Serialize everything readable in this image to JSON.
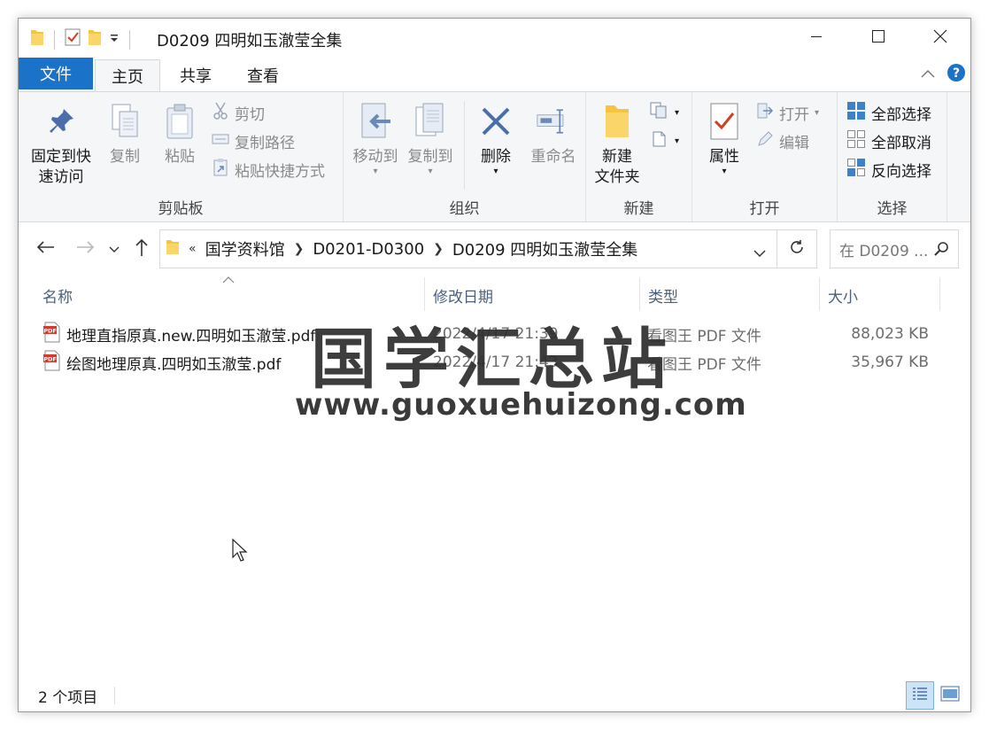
{
  "window": {
    "title": "D0209 四明如玉澈莹全集"
  },
  "ribbon_tabs": {
    "file": "文件",
    "home": "主页",
    "share": "共享",
    "view": "查看"
  },
  "clipboard": {
    "pin_line1": "固定到快",
    "pin_line2": "速访问",
    "copy": "复制",
    "paste": "粘贴",
    "cut": "剪切",
    "copy_path": "复制路径",
    "paste_shortcut": "粘贴快捷方式",
    "label": "剪贴板"
  },
  "organize": {
    "move_to": "移动到",
    "copy_to": "复制到",
    "delete": "删除",
    "rename": "重命名",
    "label": "组织"
  },
  "new_group": {
    "new_folder_line1": "新建",
    "new_folder_line2": "文件夹",
    "label": "新建"
  },
  "open_group": {
    "properties": "属性",
    "open": "打开",
    "edit": "编辑",
    "label": "打开"
  },
  "select_group": {
    "select_all": "全部选择",
    "select_none": "全部取消",
    "invert": "反向选择",
    "label": "选择"
  },
  "address": {
    "overflow": "«",
    "crumbs": [
      "国学资料馆",
      "D0201-D0300",
      "D0209 四明如玉澈莹全集"
    ],
    "search_placeholder": "在 D0209 ..."
  },
  "columns": {
    "name": "名称",
    "date": "修改日期",
    "type": "类型",
    "size": "大小"
  },
  "files": [
    {
      "name": "地理直指原真.new.四明如玉澈莹.pdf",
      "date": "2022/4/17 21:39",
      "type": "看图王 PDF 文件",
      "size": "88,023 KB"
    },
    {
      "name": "绘图地理原真.四明如玉澈莹.pdf",
      "date": "2022/4/17 21:43",
      "type": "看图王 PDF 文件",
      "size": "35,967 KB"
    }
  ],
  "watermark": {
    "title": "国学汇总站",
    "url": "www.guoxuehuizong.com"
  },
  "status": {
    "count": "2 个项目"
  },
  "colors": {
    "file_tab": "#1a73c9",
    "ribbon_bg": "#f5f6f7",
    "folder": "#f6c343",
    "help": "#1a73c9"
  }
}
